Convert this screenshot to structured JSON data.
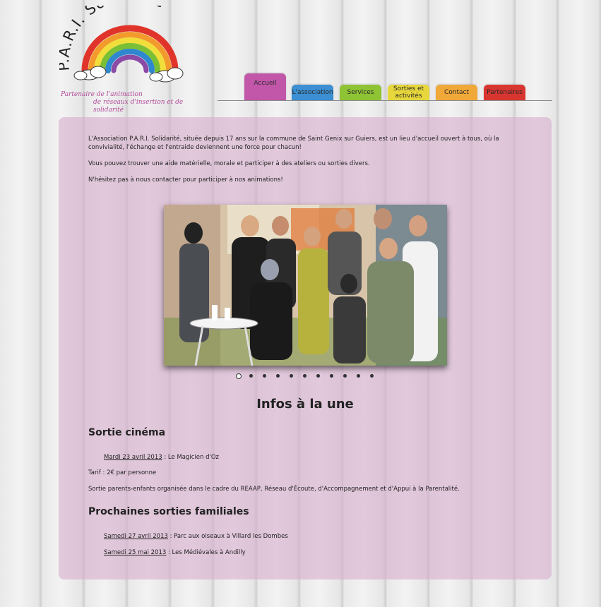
{
  "logo": {
    "title": "P.A.R.I. Solidarité",
    "tagline_line1": "Partenaire de l'animation",
    "tagline_line2": "de réseaux d'insertion et de solidarité"
  },
  "nav": {
    "tabs": [
      {
        "label": "Accueil",
        "color": "#c256a9",
        "active": true
      },
      {
        "label": "L'association",
        "color": "#3b8fd2"
      },
      {
        "label": "Services",
        "color": "#8ec334"
      },
      {
        "label": "Sorties et activités",
        "color": "#e7d73c"
      },
      {
        "label": "Contact",
        "color": "#f0a838"
      },
      {
        "label": "Partenaires",
        "color": "#d93530"
      }
    ]
  },
  "intro": {
    "p1": "L'Association P.A.R.I. Solidarité, située depuis 17 ans sur la commune de Saint Genix sur Guiers, est un lieu d'accueil ouvert à tous, où la convivialité, l'échange et l'entraide deviennent une force pour chacun!",
    "p2": "Vous pouvez trouver une aide matérielle, morale et participer à des ateliers ou sorties divers.",
    "p3": "N'hésitez pas à nous contacter pour participer à nos animations!"
  },
  "slideshow": {
    "slide_count": 11,
    "active_index": 0
  },
  "infos": {
    "heading": "Infos à la une",
    "cinema": {
      "heading": "Sortie cinéma",
      "event_date": "Mardi 23 avril 2013",
      "event_text": " : Le Magicien d'Oz",
      "tarif": "Tarif : 2€ par personne",
      "description": "Sortie parents-enfants organisée dans le cadre du REAAP, Réseau d'Écoute, d'Accompagnement et d'Appui à la Parentalité."
    },
    "familiales": {
      "heading": "Prochaines sorties familiales",
      "events": [
        {
          "date": "Samedi 27 avril 2013",
          "text": " : Parc aux oiseaux à Villard les Dombes"
        },
        {
          "date": "Samedi 25 mai 2013",
          "text": " : Les Médiévales à Andilly"
        }
      ]
    }
  },
  "colors": {
    "panel": "#dcbcd4",
    "tagline": "#b04a9a"
  }
}
